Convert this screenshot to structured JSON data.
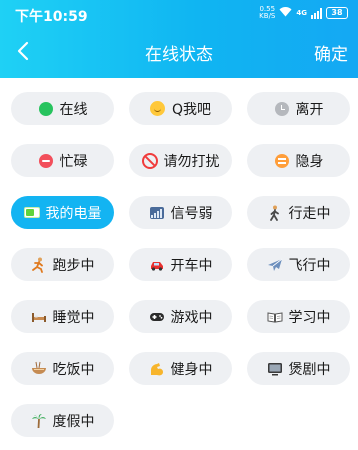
{
  "status_bar": {
    "time": "下午10:59",
    "net_speed_value": "0.55",
    "net_speed_unit": "KB/S",
    "signal_type": "4G",
    "battery": "38"
  },
  "nav": {
    "back_icon": "chevron-left-icon",
    "title": "在线状态",
    "confirm": "确定"
  },
  "colors": {
    "header_gradient_start": "#1fd1f5",
    "header_gradient_end": "#14a8f3",
    "chip_bg": "#eef0f3",
    "chip_active_bg": "#13b4f2"
  },
  "statuses": [
    {
      "label": "在线",
      "icon": "online-dot-icon",
      "selected": false
    },
    {
      "label": "Q我吧",
      "icon": "smile-icon",
      "selected": false
    },
    {
      "label": "离开",
      "icon": "clock-icon",
      "selected": false
    },
    {
      "label": "忙碌",
      "icon": "busy-icon",
      "selected": false
    },
    {
      "label": "请勿打扰",
      "icon": "do-not-disturb-icon",
      "selected": false
    },
    {
      "label": "隐身",
      "icon": "invisible-icon",
      "selected": false
    },
    {
      "label": "我的电量",
      "icon": "battery-icon",
      "selected": true
    },
    {
      "label": "信号弱",
      "icon": "weak-signal-icon",
      "selected": false
    },
    {
      "label": "行走中",
      "icon": "walking-icon",
      "selected": false
    },
    {
      "label": "跑步中",
      "icon": "running-icon",
      "selected": false
    },
    {
      "label": "开车中",
      "icon": "car-icon",
      "selected": false
    },
    {
      "label": "飞行中",
      "icon": "airplane-icon",
      "selected": false
    },
    {
      "label": "睡觉中",
      "icon": "bed-icon",
      "selected": false
    },
    {
      "label": "游戏中",
      "icon": "gamepad-icon",
      "selected": false
    },
    {
      "label": "学习中",
      "icon": "book-icon",
      "selected": false
    },
    {
      "label": "吃饭中",
      "icon": "noodle-bowl-icon",
      "selected": false
    },
    {
      "label": "健身中",
      "icon": "flexed-biceps-icon",
      "selected": false
    },
    {
      "label": "煲剧中",
      "icon": "tv-icon",
      "selected": false
    },
    {
      "label": "度假中",
      "icon": "palm-tree-icon",
      "selected": false
    }
  ]
}
